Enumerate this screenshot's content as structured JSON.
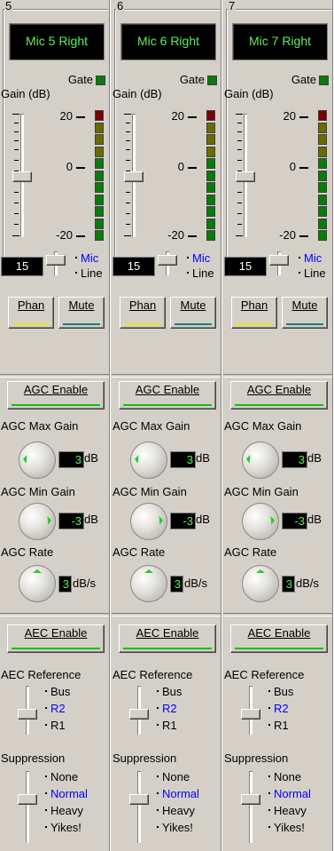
{
  "channels": [
    {
      "number": "5",
      "name": "Mic 5 Right",
      "gate_label": "Gate",
      "gain_label": "Gain (dB)",
      "meter_labels": [
        "20",
        "0",
        "-20"
      ],
      "trim_value": "15",
      "input_options": [
        "Mic",
        "Line"
      ],
      "input_selected": "Mic",
      "phan_label": "Phan",
      "mute_label": "Mute",
      "agc_enable_label": "AGC Enable",
      "agc_max_label": "AGC Max Gain",
      "agc_max_value": "3",
      "agc_max_unit": "dB",
      "agc_min_label": "AGC Min Gain",
      "agc_min_value": "-3",
      "agc_min_unit": "dB",
      "agc_rate_label": "AGC Rate",
      "agc_rate_value": "3",
      "agc_rate_unit": "dB/s",
      "aec_enable_label": "AEC Enable",
      "aec_ref_label": "AEC Reference",
      "aec_ref_options": [
        "Bus",
        "R2",
        "R1"
      ],
      "aec_ref_selected": "R2",
      "suppression_label": "Suppression",
      "suppression_options": [
        "None",
        "Normal",
        "Heavy",
        "Yikes!"
      ],
      "suppression_selected": "Normal"
    },
    {
      "number": "6",
      "name": "Mic 6 Right",
      "gate_label": "Gate",
      "gain_label": "Gain (dB)",
      "meter_labels": [
        "20",
        "0",
        "-20"
      ],
      "trim_value": "15",
      "input_options": [
        "Mic",
        "Line"
      ],
      "input_selected": "Mic",
      "phan_label": "Phan",
      "mute_label": "Mute",
      "agc_enable_label": "AGC Enable",
      "agc_max_label": "AGC Max Gain",
      "agc_max_value": "3",
      "agc_max_unit": "dB",
      "agc_min_label": "AGC Min Gain",
      "agc_min_value": "-3",
      "agc_min_unit": "dB",
      "agc_rate_label": "AGC Rate",
      "agc_rate_value": "3",
      "agc_rate_unit": "dB/s",
      "aec_enable_label": "AEC Enable",
      "aec_ref_label": "AEC Reference",
      "aec_ref_options": [
        "Bus",
        "R2",
        "R1"
      ],
      "aec_ref_selected": "R2",
      "suppression_label": "Suppression",
      "suppression_options": [
        "None",
        "Normal",
        "Heavy",
        "Yikes!"
      ],
      "suppression_selected": "Normal"
    },
    {
      "number": "7",
      "name": "Mic 7 Right",
      "gate_label": "Gate",
      "gain_label": "Gain (dB)",
      "meter_labels": [
        "20",
        "0",
        "-20"
      ],
      "trim_value": "15",
      "input_options": [
        "Mic",
        "Line"
      ],
      "input_selected": "Mic",
      "phan_label": "Phan",
      "mute_label": "Mute",
      "agc_enable_label": "AGC Enable",
      "agc_max_label": "AGC Max Gain",
      "agc_max_value": "3",
      "agc_max_unit": "dB",
      "agc_min_label": "AGC Min Gain",
      "agc_min_value": "-3",
      "agc_min_unit": "dB",
      "agc_rate_label": "AGC Rate",
      "agc_rate_value": "3",
      "agc_rate_unit": "dB/s",
      "aec_enable_label": "AEC Enable",
      "aec_ref_label": "AEC Reference",
      "aec_ref_options": [
        "Bus",
        "R2",
        "R1"
      ],
      "aec_ref_selected": "R2",
      "suppression_label": "Suppression",
      "suppression_options": [
        "None",
        "Normal",
        "Heavy",
        "Yikes!"
      ],
      "suppression_selected": "Normal"
    }
  ],
  "colors": {
    "panel": "#d4d0c8",
    "name_text": "#5cf05c",
    "selected_option": "#0000ff",
    "phan_bar": "#e8e800",
    "mute_bar": "#1a7a8a",
    "enable_bar": "#10c010",
    "meter_clip": "#7a0000",
    "meter_hi": "#6a6a00",
    "meter_mid": "#0a7a0a",
    "gate_led": "#0a7a0a",
    "knob_pointer": "#20d020"
  }
}
